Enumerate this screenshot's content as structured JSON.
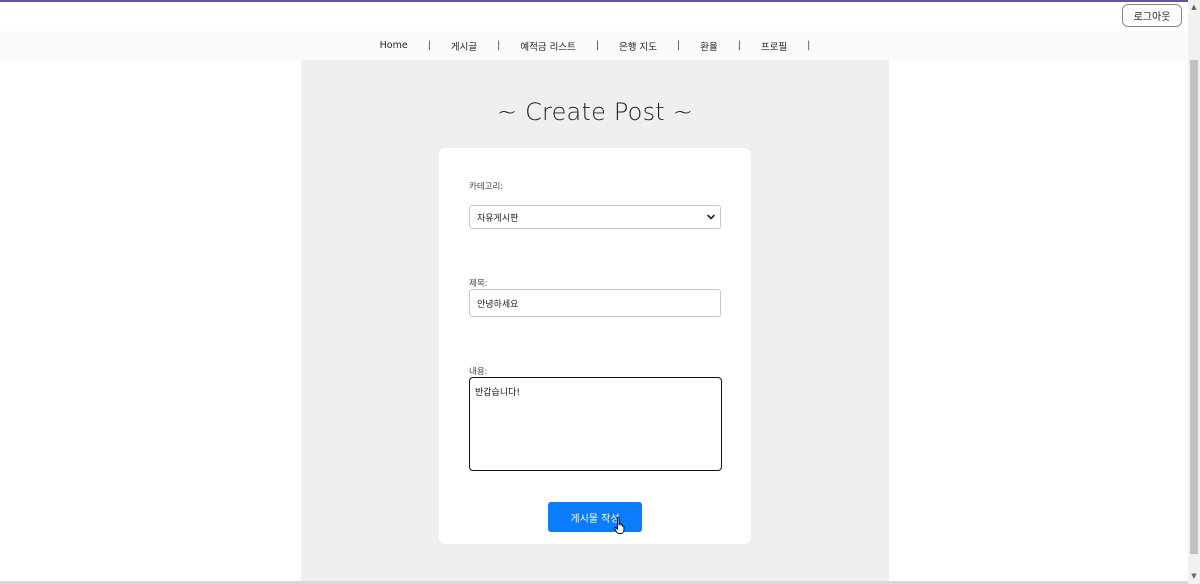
{
  "header": {
    "logout_label": "로그아웃"
  },
  "nav": {
    "items": [
      {
        "label": "Home"
      },
      {
        "label": "게시글"
      },
      {
        "label": "예적금 리스트"
      },
      {
        "label": "은행 지도"
      },
      {
        "label": "환율"
      },
      {
        "label": "프로필"
      }
    ],
    "separator": "|"
  },
  "page": {
    "title": "~ Create Post ~"
  },
  "form": {
    "category_label": "카테고리:",
    "category_value": "자유게시판",
    "title_label": "제목:",
    "title_value": "안녕하세요",
    "content_label": "내용:",
    "content_value": "반갑습니다!",
    "submit_label": "게시물 작성"
  },
  "colors": {
    "accent": "#0a7cff",
    "top_border": "#6a4fa3",
    "content_background": "#efefef"
  },
  "icons": {
    "select_arrow": "chevron-down-icon",
    "cursor": "hand-pointer-icon"
  }
}
